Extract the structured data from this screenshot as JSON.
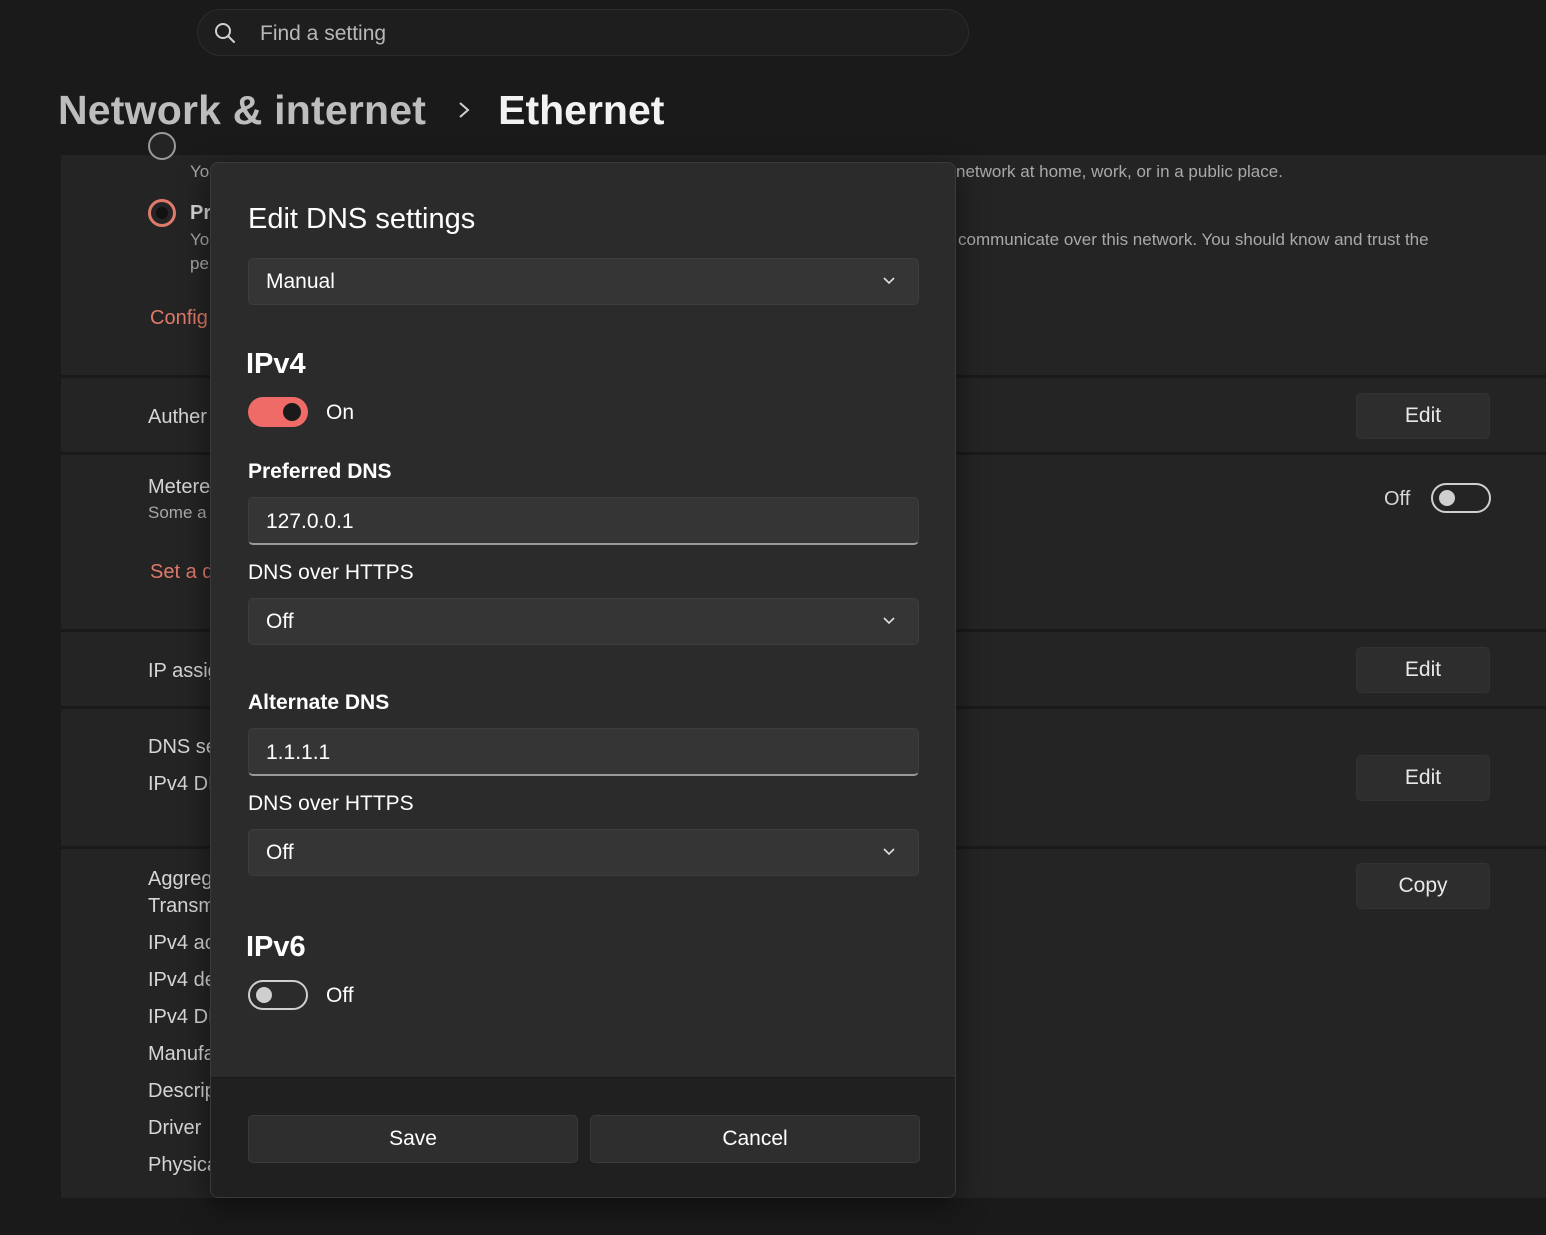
{
  "search": {
    "placeholder": "Find a setting"
  },
  "breadcrumb": {
    "parent": "Network & internet",
    "current": "Ethernet"
  },
  "background": {
    "profile": {
      "public_desc_tail": "network at home, work, or in a public place.",
      "private_label": "Pr",
      "private_desc_head": "Yo",
      "private_desc_head2": "pe",
      "public_desc_head": "Yo",
      "private_desc_tail": "communicate over this network. You should know and trust the",
      "config_link": "Config"
    },
    "auth": {
      "label": "Auther",
      "button": "Edit"
    },
    "metered": {
      "label": "Metere",
      "sub": "Some a",
      "toggle_label": "Off",
      "toggle_on": false,
      "link": "Set a d"
    },
    "ip": {
      "label": "IP assig",
      "button": "Edit"
    },
    "dns": {
      "label": "DNS se",
      "sub": "IPv4 DI",
      "button": "Edit"
    },
    "props": {
      "button": "Copy",
      "rows": [
        "Aggreg",
        "Transm",
        "IPv4 ac",
        "IPv4 de",
        "IPv4 DI",
        "Manufa",
        "Descrip",
        "Driver",
        "Physica"
      ]
    }
  },
  "dialog": {
    "title": "Edit DNS settings",
    "mode": "Manual",
    "ipv4": {
      "heading": "IPv4",
      "toggle_on": true,
      "toggle_label": "On",
      "preferred_label": "Preferred DNS",
      "preferred_value": "127.0.0.1",
      "preferred_doh_label": "DNS over HTTPS",
      "preferred_doh_value": "Off",
      "alternate_label": "Alternate DNS",
      "alternate_value": "1.1.1.1",
      "alternate_doh_label": "DNS over HTTPS",
      "alternate_doh_value": "Off"
    },
    "ipv6": {
      "heading": "IPv6",
      "toggle_on": false,
      "toggle_label": "Off"
    },
    "save": "Save",
    "cancel": "Cancel"
  },
  "colors": {
    "accent": "#ef6b68",
    "link": "#e07a6a",
    "background": "#1a1a1a",
    "dialog": "#2b2b2b"
  }
}
